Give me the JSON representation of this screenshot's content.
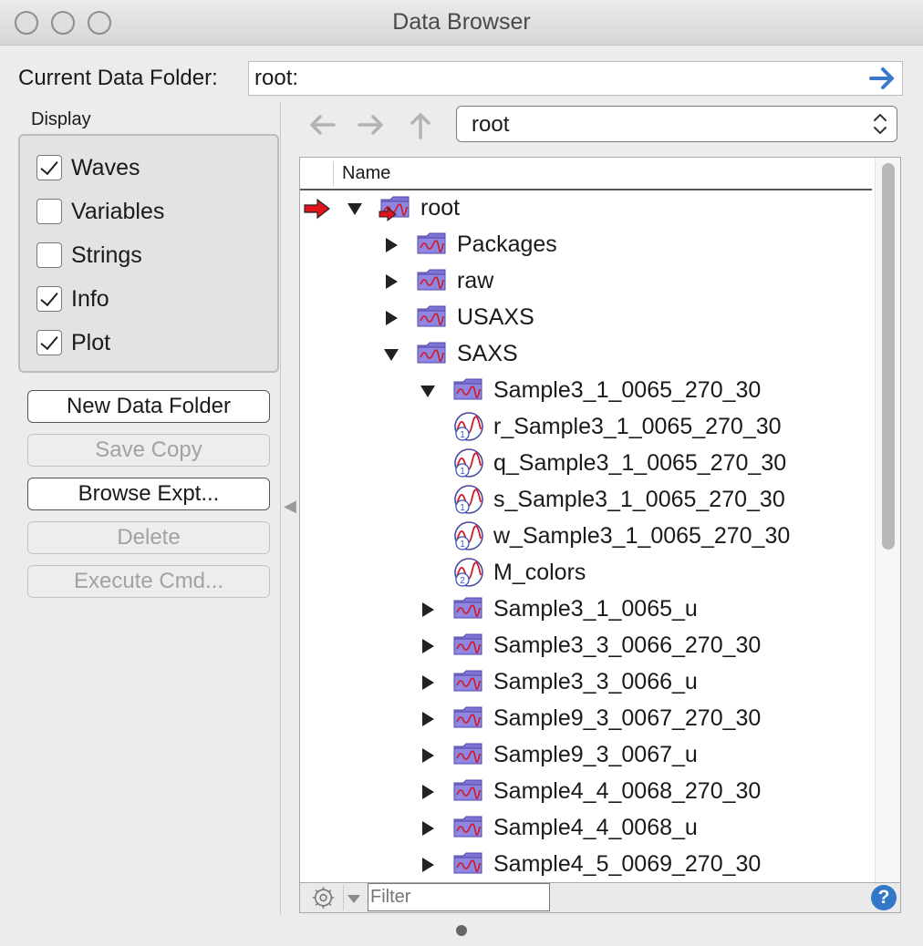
{
  "window": {
    "title": "Data Browser"
  },
  "current_folder": {
    "label": "Current Data Folder:",
    "value": "root:"
  },
  "display": {
    "label": "Display",
    "options": [
      {
        "label": "Waves",
        "checked": true
      },
      {
        "label": "Variables",
        "checked": false
      },
      {
        "label": "Strings",
        "checked": false
      },
      {
        "label": "Info",
        "checked": true
      },
      {
        "label": "Plot",
        "checked": true
      }
    ]
  },
  "buttons": [
    {
      "label": "New Data Folder",
      "enabled": true
    },
    {
      "label": "Save Copy",
      "enabled": false
    },
    {
      "label": "Browse Expt...",
      "enabled": true
    },
    {
      "label": "Delete",
      "enabled": false
    },
    {
      "label": "Execute Cmd...",
      "enabled": false
    }
  ],
  "location_popup": {
    "value": "root"
  },
  "tree": {
    "column_header": "Name",
    "rows": [
      {
        "label": "root",
        "depth": 0,
        "kind": "folder",
        "expanded": true,
        "current": true
      },
      {
        "label": "Packages",
        "depth": 1,
        "kind": "folder",
        "expanded": false
      },
      {
        "label": "raw",
        "depth": 1,
        "kind": "folder",
        "expanded": false
      },
      {
        "label": "USAXS",
        "depth": 1,
        "kind": "folder",
        "expanded": false
      },
      {
        "label": "SAXS",
        "depth": 1,
        "kind": "folder",
        "expanded": true
      },
      {
        "label": "Sample3_1_0065_270_30",
        "depth": 2,
        "kind": "folder",
        "expanded": true
      },
      {
        "label": "r_Sample3_1_0065_270_30",
        "depth": 3,
        "kind": "wave",
        "dims": "1"
      },
      {
        "label": "q_Sample3_1_0065_270_30",
        "depth": 3,
        "kind": "wave",
        "dims": "1"
      },
      {
        "label": "s_Sample3_1_0065_270_30",
        "depth": 3,
        "kind": "wave",
        "dims": "1"
      },
      {
        "label": "w_Sample3_1_0065_270_30",
        "depth": 3,
        "kind": "wave",
        "dims": "1"
      },
      {
        "label": "M_colors",
        "depth": 3,
        "kind": "wave",
        "dims": "2"
      },
      {
        "label": "Sample3_1_0065_u",
        "depth": 2,
        "kind": "folder",
        "expanded": false
      },
      {
        "label": "Sample3_3_0066_270_30",
        "depth": 2,
        "kind": "folder",
        "expanded": false
      },
      {
        "label": "Sample3_3_0066_u",
        "depth": 2,
        "kind": "folder",
        "expanded": false
      },
      {
        "label": "Sample9_3_0067_270_30",
        "depth": 2,
        "kind": "folder",
        "expanded": false
      },
      {
        "label": "Sample9_3_0067_u",
        "depth": 2,
        "kind": "folder",
        "expanded": false
      },
      {
        "label": "Sample4_4_0068_270_30",
        "depth": 2,
        "kind": "folder",
        "expanded": false
      },
      {
        "label": "Sample4_4_0068_u",
        "depth": 2,
        "kind": "folder",
        "expanded": false
      },
      {
        "label": "Sample4_5_0069_270_30",
        "depth": 2,
        "kind": "folder",
        "expanded": false
      }
    ]
  },
  "filter": {
    "placeholder": "Filter",
    "value": ""
  },
  "help": {
    "label": "?"
  },
  "colors": {
    "accent": "#3277c8",
    "folder": "#7d72d6",
    "current_marker": "#e0151b"
  }
}
